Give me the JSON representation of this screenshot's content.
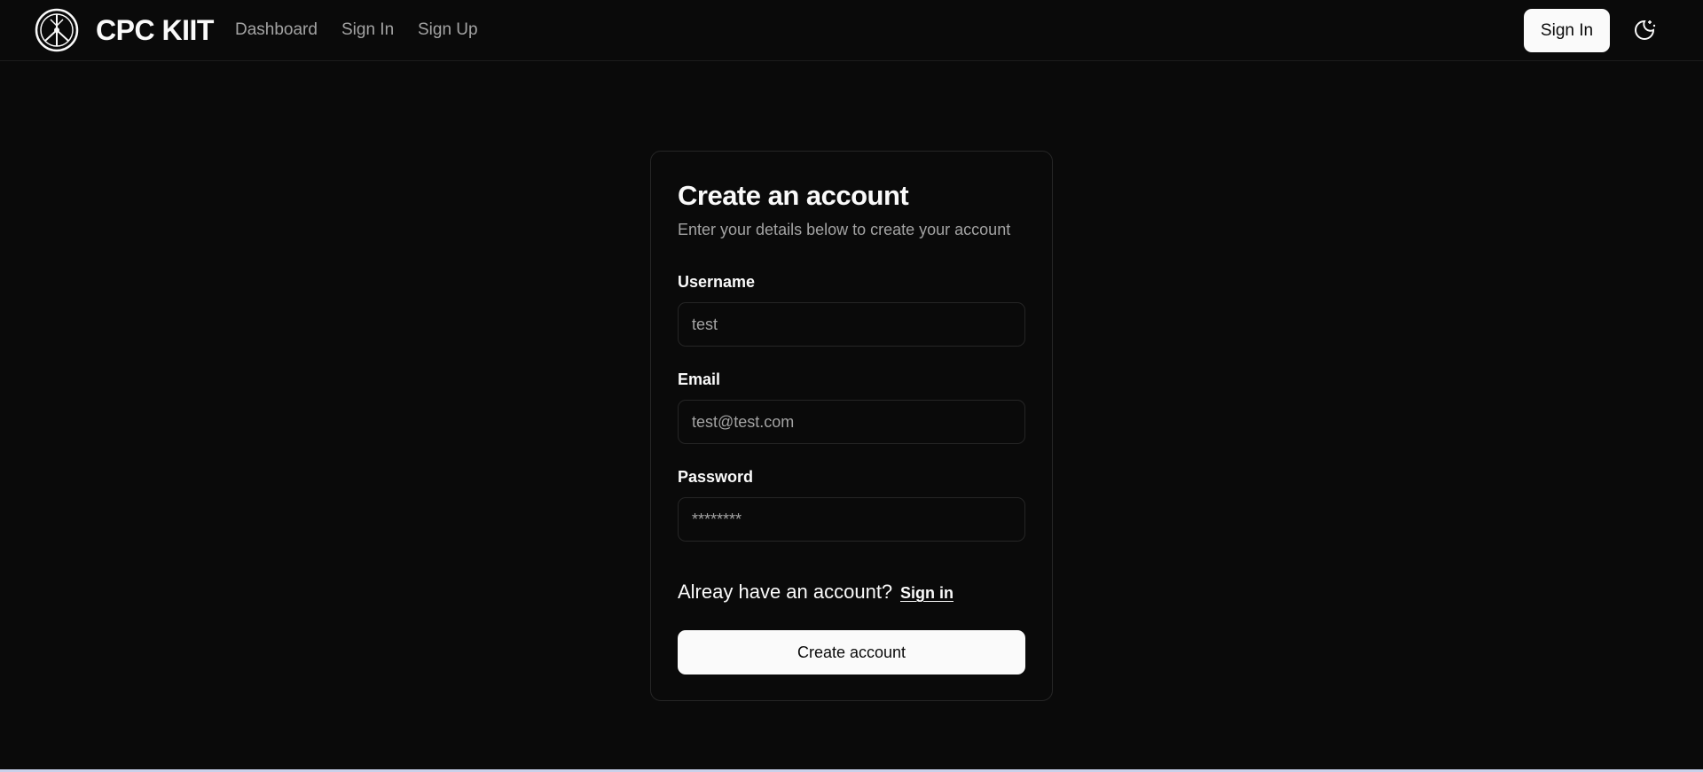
{
  "nav": {
    "brand": "CPC KIIT",
    "links": [
      {
        "label": "Dashboard"
      },
      {
        "label": "Sign In"
      },
      {
        "label": "Sign Up"
      }
    ],
    "signin_button": "Sign In",
    "logo_icon": "cpc-logo-icon",
    "theme_icon": "moon-sun-icon"
  },
  "form": {
    "title": "Create an account",
    "subtitle": "Enter your details below to create your account",
    "username": {
      "label": "Username",
      "placeholder": "test",
      "value": ""
    },
    "email": {
      "label": "Email",
      "placeholder": "test@test.com",
      "value": ""
    },
    "password": {
      "label": "Password",
      "placeholder": "********",
      "value": ""
    },
    "account_prompt": "Alreay have an account?",
    "signin_link": "Sign in",
    "submit": "Create account"
  },
  "colors": {
    "background": "#0a0a0a",
    "border": "#262626",
    "primary": "#fafafa",
    "muted": "#a3a3a3"
  }
}
